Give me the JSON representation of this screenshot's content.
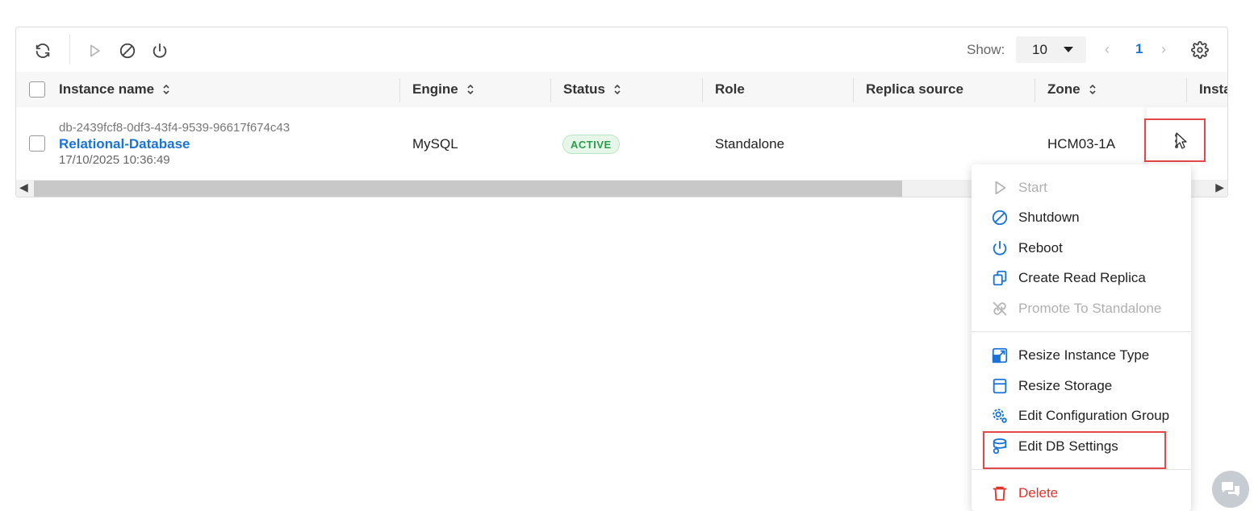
{
  "toolbar": {
    "show_label": "Show:",
    "page_size": "10",
    "current_page": "1",
    "prev_symbol": "‹",
    "next_symbol": "›"
  },
  "table": {
    "columns": [
      {
        "label": "Instance name",
        "sortable": true
      },
      {
        "label": "Engine",
        "sortable": true
      },
      {
        "label": "Status",
        "sortable": true
      },
      {
        "label": "Role",
        "sortable": false
      },
      {
        "label": "Replica source",
        "sortable": false
      },
      {
        "label": "Zone",
        "sortable": true
      },
      {
        "label": "Insta",
        "sortable": false
      }
    ],
    "rows": [
      {
        "instance_id": "db-2439fcf8-0df3-43f4-9539-96617f674c43",
        "instance_name": "Relational-Database",
        "created": "17/10/2025 10:36:49",
        "engine": "MySQL",
        "status": "ACTIVE",
        "role": "Standalone",
        "replica_source": "",
        "zone": "HCM03-1A"
      }
    ]
  },
  "menu": {
    "items": [
      {
        "label": "Start",
        "icon": "play-icon",
        "disabled": true
      },
      {
        "label": "Shutdown",
        "icon": "ban-icon",
        "disabled": false
      },
      {
        "label": "Reboot",
        "icon": "power-icon",
        "disabled": false
      },
      {
        "label": "Create Read Replica",
        "icon": "copy-icon",
        "disabled": false
      },
      {
        "label": "Promote To Standalone",
        "icon": "unlink-icon",
        "disabled": true
      },
      {
        "label": "Resize Instance Type",
        "icon": "resize-icon",
        "disabled": false
      },
      {
        "label": "Resize Storage",
        "icon": "storage-icon",
        "disabled": false
      },
      {
        "label": "Edit Configuration Group",
        "icon": "gears-icon",
        "disabled": false
      },
      {
        "label": "Edit DB Settings",
        "icon": "database-settings-icon",
        "disabled": false
      },
      {
        "label": "Delete",
        "icon": "trash-icon",
        "disabled": false
      }
    ]
  },
  "colors": {
    "accent": "#1a73d9",
    "status_active": "#2a9d4a",
    "danger": "#e0342b",
    "highlight": "#e34848"
  }
}
